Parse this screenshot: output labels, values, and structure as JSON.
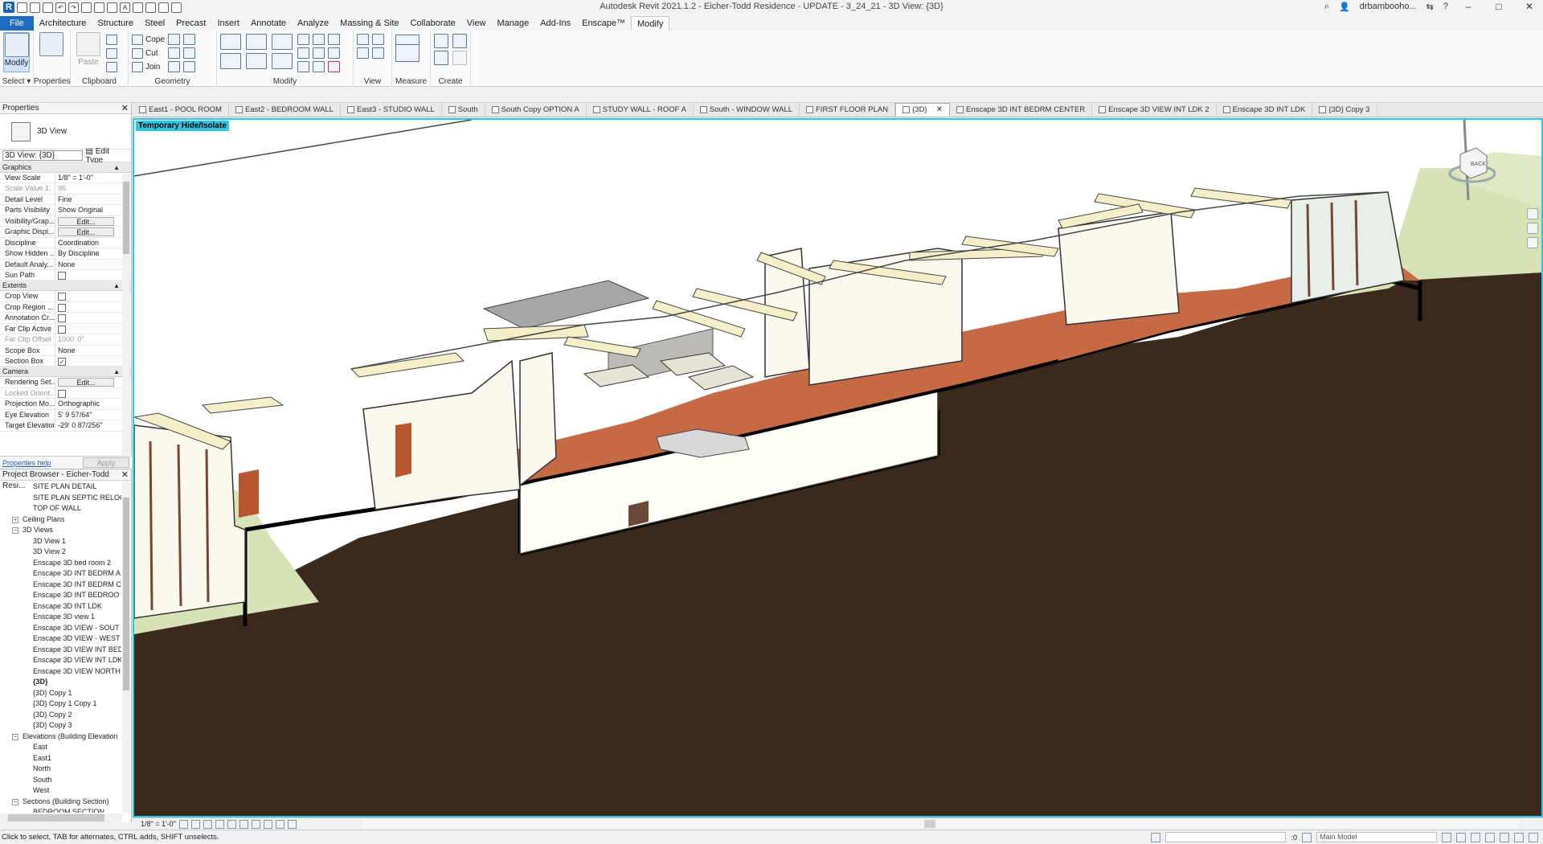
{
  "app": {
    "title": "Autodesk Revit 2021.1.2 - Eicher-Todd Residence - UPDATE - 3_24_21 - 3D View: {3D}",
    "user": "drbambooho...",
    "logo": "R"
  },
  "menu": {
    "tabs": [
      "File",
      "Architecture",
      "Structure",
      "Steel",
      "Precast",
      "Insert",
      "Annotate",
      "Analyze",
      "Massing & Site",
      "Collaborate",
      "View",
      "Manage",
      "Add-Ins",
      "Enscape™",
      "Modify"
    ],
    "active": "Modify"
  },
  "ribbon": {
    "select_label": "Modify",
    "select_panel": "Select ▾",
    "properties_label": "Properties",
    "clipboard": {
      "paste": "Paste",
      "panel": "Clipboard"
    },
    "geometry": {
      "cope": "Cope",
      "cut": "Cut",
      "join": "Join",
      "panel": "Geometry"
    },
    "modify_panel": "Modify",
    "view_panel": "View",
    "measure_panel": "Measure",
    "create_panel": "Create"
  },
  "properties": {
    "title": "Properties",
    "type_name": "3D View",
    "selector": "3D View: {3D}",
    "edit_type": "Edit Type",
    "groups": [
      {
        "name": "Graphics",
        "rows": [
          {
            "k": "View Scale",
            "v": "1/8\" = 1'-0\""
          },
          {
            "k": "Scale Value    1:",
            "v": "96",
            "dis": true
          },
          {
            "k": "Detail Level",
            "v": "Fine"
          },
          {
            "k": "Parts Visibility",
            "v": "Show Original"
          },
          {
            "k": "Visibility/Grap...",
            "v": "Edit...",
            "btn": true
          },
          {
            "k": "Graphic Displ...",
            "v": "Edit...",
            "btn": true
          },
          {
            "k": "Discipline",
            "v": "Coordination"
          },
          {
            "k": "Show Hidden ...",
            "v": "By Discipline"
          },
          {
            "k": "Default Analy...",
            "v": "None"
          },
          {
            "k": "Sun Path",
            "v": "",
            "cb": true
          }
        ]
      },
      {
        "name": "Extents",
        "rows": [
          {
            "k": "Crop View",
            "v": "",
            "cb": true
          },
          {
            "k": "Crop Region ...",
            "v": "",
            "cb": true
          },
          {
            "k": "Annotation Cr...",
            "v": "",
            "cb": true
          },
          {
            "k": "Far Clip Active",
            "v": "",
            "cb": true
          },
          {
            "k": "Far Clip Offset",
            "v": "1000'  0\"",
            "dis": true
          },
          {
            "k": "Scope Box",
            "v": "None"
          },
          {
            "k": "Section Box",
            "v": "✓",
            "cb": true
          }
        ]
      },
      {
        "name": "Camera",
        "rows": [
          {
            "k": "Rendering Set...",
            "v": "Edit...",
            "btn": true
          },
          {
            "k": "Locked Orient...",
            "v": "",
            "cb": true,
            "dis": true
          },
          {
            "k": "Projection Mo...",
            "v": "Orthographic"
          },
          {
            "k": "Eye Elevation",
            "v": "5'  9 57/64\""
          },
          {
            "k": "Target Elevation",
            "v": "-29'  0 87/256\""
          }
        ]
      }
    ],
    "help": "Properties help",
    "apply": "Apply"
  },
  "browser": {
    "title": "Project Browser - Eicher-Todd Resi...",
    "items": [
      {
        "t": "SITE PLAN DETAIL",
        "d": 3
      },
      {
        "t": "SITE PLAN SEPTIC RELOCA",
        "d": 3
      },
      {
        "t": "TOP OF WALL",
        "d": 3
      },
      {
        "t": "Ceiling Plans",
        "d": 1,
        "tog": "+"
      },
      {
        "t": "3D Views",
        "d": 1,
        "tog": "−"
      },
      {
        "t": "3D View 1",
        "d": 3
      },
      {
        "t": "3D View 2",
        "d": 3
      },
      {
        "t": "Enscape 3D bed room 2",
        "d": 3
      },
      {
        "t": "Enscape 3D INT BEDRM A",
        "d": 3
      },
      {
        "t": "Enscape 3D INT BEDRM C",
        "d": 3
      },
      {
        "t": "Enscape 3D INT BEDROO",
        "d": 3
      },
      {
        "t": "Enscape 3D INT LDK",
        "d": 3
      },
      {
        "t": "Enscape 3D view 1",
        "d": 3
      },
      {
        "t": "Enscape 3D VIEW - SOUT",
        "d": 3
      },
      {
        "t": "Enscape 3D VIEW - WEST",
        "d": 3
      },
      {
        "t": "Enscape 3D VIEW INT BED",
        "d": 3
      },
      {
        "t": "Enscape 3D VIEW INT LDK",
        "d": 3
      },
      {
        "t": "Enscape 3D VIEW NORTH",
        "d": 3
      },
      {
        "t": "{3D}",
        "d": 3,
        "bold": true
      },
      {
        "t": "{3D} Copy 1",
        "d": 3
      },
      {
        "t": "{3D} Copy 1 Copy 1",
        "d": 3
      },
      {
        "t": "{3D} Copy 2",
        "d": 3
      },
      {
        "t": "{3D} Copy 3",
        "d": 3
      },
      {
        "t": "Elevations (Building Elevation",
        "d": 1,
        "tog": "−"
      },
      {
        "t": "East",
        "d": 3
      },
      {
        "t": "East1",
        "d": 3
      },
      {
        "t": "North",
        "d": 3
      },
      {
        "t": "South",
        "d": 3
      },
      {
        "t": "West",
        "d": 3
      },
      {
        "t": "Sections (Building Section)",
        "d": 1,
        "tog": "−"
      },
      {
        "t": "BEDROOM SECTION",
        "d": 3
      }
    ]
  },
  "view_tabs": [
    {
      "t": "East1 - POOL ROOM"
    },
    {
      "t": "East2 - BEDROOM WALL"
    },
    {
      "t": "East3 - STUDIO WALL"
    },
    {
      "t": "South"
    },
    {
      "t": "South Copy OPTION A"
    },
    {
      "t": "STUDY WALL - ROOF A"
    },
    {
      "t": "South - WINDOW WALL"
    },
    {
      "t": "FIRST FLOOR PLAN"
    },
    {
      "t": "{3D}",
      "active": true
    },
    {
      "t": "Enscape 3D INT BEDRM CENTER"
    },
    {
      "t": "Enscape 3D VIEW INT LDK 2"
    },
    {
      "t": "Enscape 3D INT LDK"
    },
    {
      "t": "{3D} Copy 3"
    }
  ],
  "viewport": {
    "hide_isolate": "Temporary Hide/Isolate",
    "viewcube_label": "BACK",
    "viewcube_side": "RIGHT"
  },
  "view_control": {
    "scale": "1/8\" = 1'-0\""
  },
  "status": {
    "text": "Click to select, TAB for alternates, CTRL adds, SHIFT unselects.",
    "worksets": ":0",
    "model": "Main Model"
  },
  "colors": {
    "accent": "#2cc7e0",
    "file_tab": "#1e6bbf",
    "ground": "#3b2a1c",
    "grass": "#d7e3b6",
    "floor": "#c66a45",
    "beam": "#f4efc8"
  }
}
